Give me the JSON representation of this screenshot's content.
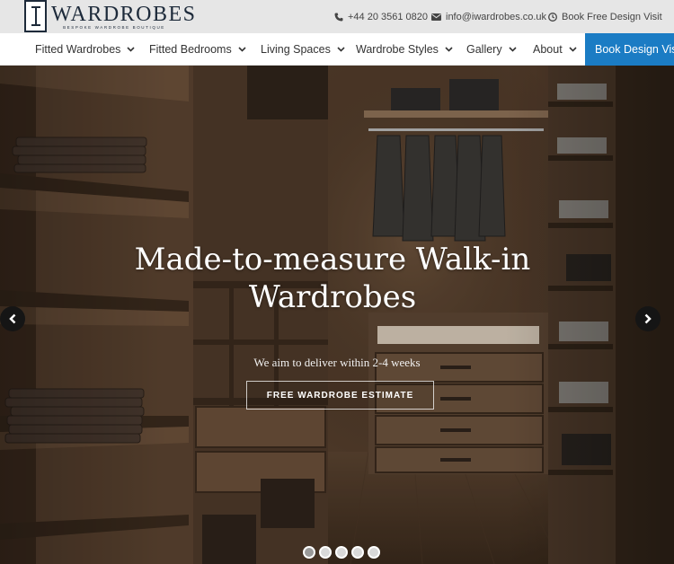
{
  "logo": {
    "word": "WARDROBES",
    "tagline": "BESPOKE WARDROBE BOUTIQUE",
    "icon": "i-monogram-icon"
  },
  "contact": {
    "phone": "+44 20 3561 0820",
    "email": "info@iwardrobes.co.uk",
    "book": "Book Free Design Visit"
  },
  "nav": {
    "items": [
      {
        "label": "Fitted Wardrobes"
      },
      {
        "label": "Fitted Bedrooms"
      },
      {
        "label": "Living Spaces"
      },
      {
        "label": "Wardrobe Styles"
      },
      {
        "label": "Gallery"
      },
      {
        "label": "About"
      }
    ],
    "cta": "Book Design Visit"
  },
  "hero": {
    "title_line1": "Made-to-measure Walk-in",
    "title_line2": "Wardrobes",
    "subtitle": "We aim to deliver within 2-4 weeks",
    "button": "FREE WARDROBE ESTIMATE",
    "slides": 5,
    "active_slide": 1
  },
  "colors": {
    "topbar_bg": "#e6e6e6",
    "brand_navy": "#1d2a3a",
    "cta_blue": "#1b7cc4",
    "wood_dark": "#3a2a1e"
  }
}
